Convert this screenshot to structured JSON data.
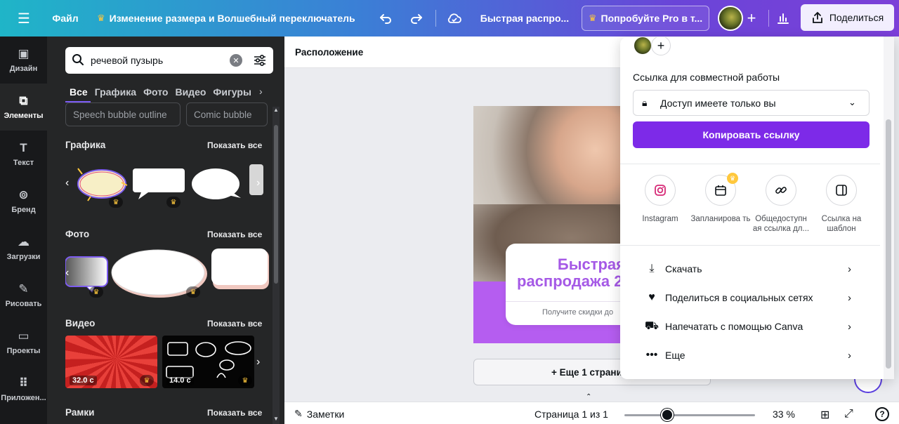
{
  "topbar": {
    "menu_icon": "hamburger-icon",
    "file_label": "Файл",
    "title": "Изменение размера и Волшебный переключатель",
    "doc_name": "Быстрая распро...",
    "try_pro": "Попробуйте Pro в т...",
    "share_label": "Поделиться",
    "colors": {
      "gradient_start": "#1fb5c8",
      "gradient_end": "#7b3fd8"
    }
  },
  "rail": {
    "items": [
      {
        "label": "Дизайн",
        "icon": "design-icon"
      },
      {
        "label": "Элементы",
        "icon": "elements-icon"
      },
      {
        "label": "Текст",
        "icon": "text-icon"
      },
      {
        "label": "Бренд",
        "icon": "brand-icon"
      },
      {
        "label": "Загрузки",
        "icon": "uploads-icon"
      },
      {
        "label": "Рисовать",
        "icon": "draw-icon"
      },
      {
        "label": "Проекты",
        "icon": "folder-icon"
      },
      {
        "label": "Приложен...",
        "icon": "apps-icon"
      }
    ]
  },
  "panel": {
    "search_value": "речевой пузырь",
    "tabs": [
      "Все",
      "Графика",
      "Фото",
      "Видео",
      "Фигуры"
    ],
    "chips": [
      "Speech bubble outline",
      "Comic bubble"
    ],
    "sections": {
      "graphics": {
        "title": "Графика",
        "show_all": "Показать все"
      },
      "photos": {
        "title": "Фото",
        "show_all": "Показать все"
      },
      "videos": {
        "title": "Видео",
        "show_all": "Показать все"
      },
      "frames": {
        "title": "Рамки",
        "show_all": "Показать все"
      }
    },
    "video_durations": [
      "32.0 с",
      "14.0 с"
    ]
  },
  "canvas": {
    "toolbar_label": "Расположение",
    "card_line1": "Быстрая",
    "card_line2": "распродажа 2",
    "card_sub": "Получите скидки до",
    "add_page": "+ Еще 1 страни"
  },
  "bottombar": {
    "notes": "Заметки",
    "page": "Страница 1 из 1",
    "zoom": "33 %",
    "zoom_fraction": 0.33,
    "help": "?"
  },
  "share_dropdown": {
    "collab_label": "Ссылка для совместной работы",
    "access_value": "Доступ имеете только вы",
    "copy_button": "Копировать ссылку",
    "options": [
      {
        "label": "Instagram",
        "icon": "instagram-icon"
      },
      {
        "label": "Запланирова ть",
        "icon": "calendar-icon"
      },
      {
        "label": "Общедоступн ая ссылка дл...",
        "icon": "link-icon"
      },
      {
        "label": "Ссылка на шаблон",
        "icon": "template-icon"
      }
    ],
    "rows": [
      {
        "label": "Скачать",
        "icon": "download-icon"
      },
      {
        "label": "Поделиться в социальных сетях",
        "icon": "heart-icon"
      },
      {
        "label": "Напечатать с помощью Canva",
        "icon": "truck-icon"
      },
      {
        "label": "Еще",
        "icon": "more-icon"
      }
    ],
    "accent": "#7d2ae8"
  }
}
